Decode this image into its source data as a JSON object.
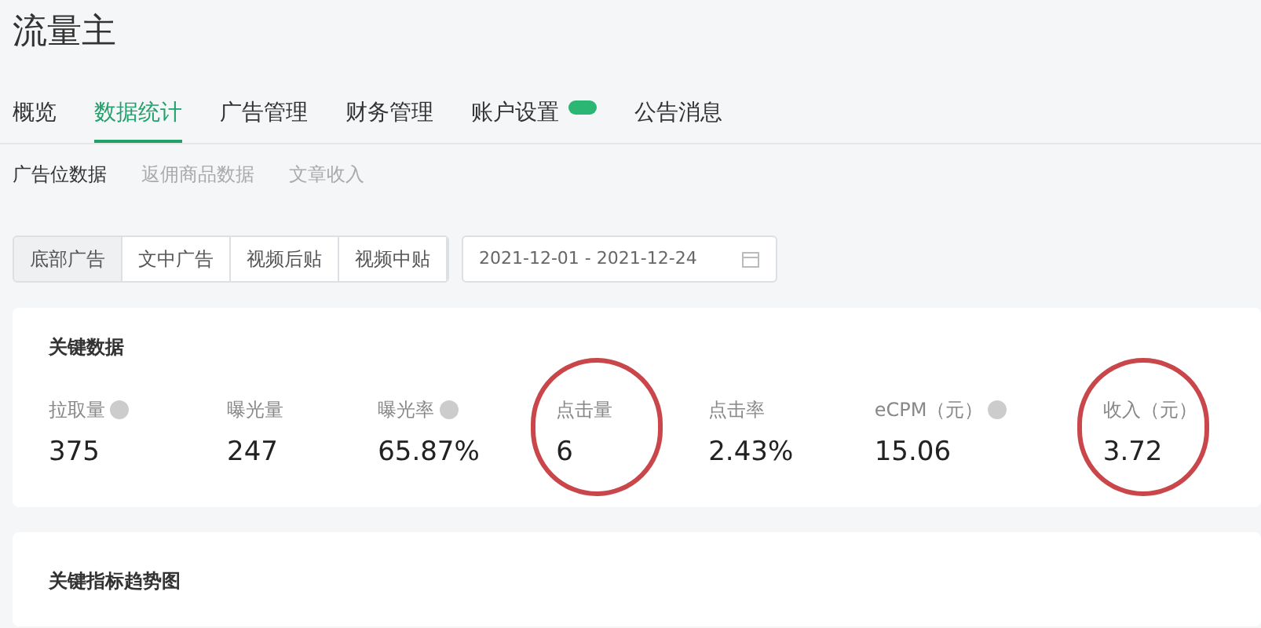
{
  "app_title": "流量主",
  "tabs": [
    {
      "label": "概览",
      "selected": false,
      "badge": false
    },
    {
      "label": "数据统计",
      "selected": true,
      "badge": false
    },
    {
      "label": "广告管理",
      "selected": false,
      "badge": false
    },
    {
      "label": "财务管理",
      "selected": false,
      "badge": false
    },
    {
      "label": "账户设置",
      "selected": false,
      "badge": true
    },
    {
      "label": "公告消息",
      "selected": false,
      "badge": false
    }
  ],
  "subtabs": [
    {
      "label": "广告位数据",
      "selected": true
    },
    {
      "label": "返佣商品数据",
      "selected": false
    },
    {
      "label": "文章收入",
      "selected": false
    }
  ],
  "ad_types": [
    {
      "label": "底部广告",
      "selected": true
    },
    {
      "label": "文中广告",
      "selected": false
    },
    {
      "label": "视频后贴",
      "selected": false
    },
    {
      "label": "视频中贴",
      "selected": false
    }
  ],
  "date_range": {
    "value": "2021-12-01 - 2021-12-24"
  },
  "key_data": {
    "title": "关键数据",
    "metrics": [
      {
        "label": "拉取量",
        "value": "375",
        "help": true,
        "circled": false
      },
      {
        "label": "曝光量",
        "value": "247",
        "help": false,
        "circled": false
      },
      {
        "label": "曝光率",
        "value": "65.87%",
        "help": true,
        "circled": false
      },
      {
        "label": "点击量",
        "value": "6",
        "help": false,
        "circled": true
      },
      {
        "label": "点击率",
        "value": "2.43%",
        "help": false,
        "circled": false
      },
      {
        "label": "eCPM（元）",
        "value": "15.06",
        "help": true,
        "circled": false
      },
      {
        "label": "收入（元）",
        "value": "3.72",
        "help": false,
        "circled": true
      }
    ]
  },
  "trend": {
    "title": "关键指标趋势图"
  }
}
